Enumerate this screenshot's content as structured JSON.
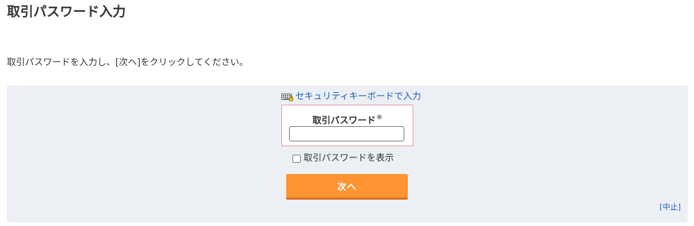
{
  "page": {
    "title": "取引パスワード入力",
    "instruction": "取引パスワードを入力し、[次へ]をクリックしてください。"
  },
  "form": {
    "keyboard_icon": "keyboard-icon",
    "security_keyboard_link": "セキュリティキーボードで入力",
    "password_label": "取引パスワード",
    "required_mark": "※",
    "password_value": "",
    "show_password_label": "取引パスワードを表示",
    "show_password_checked": false,
    "next_button": "次へ",
    "cancel_link": "[中止]"
  },
  "colors": {
    "panel_background": "#ecf0f4",
    "button": "#ff9433",
    "link": "#1a5bb5",
    "field_border": "#e6979b"
  }
}
